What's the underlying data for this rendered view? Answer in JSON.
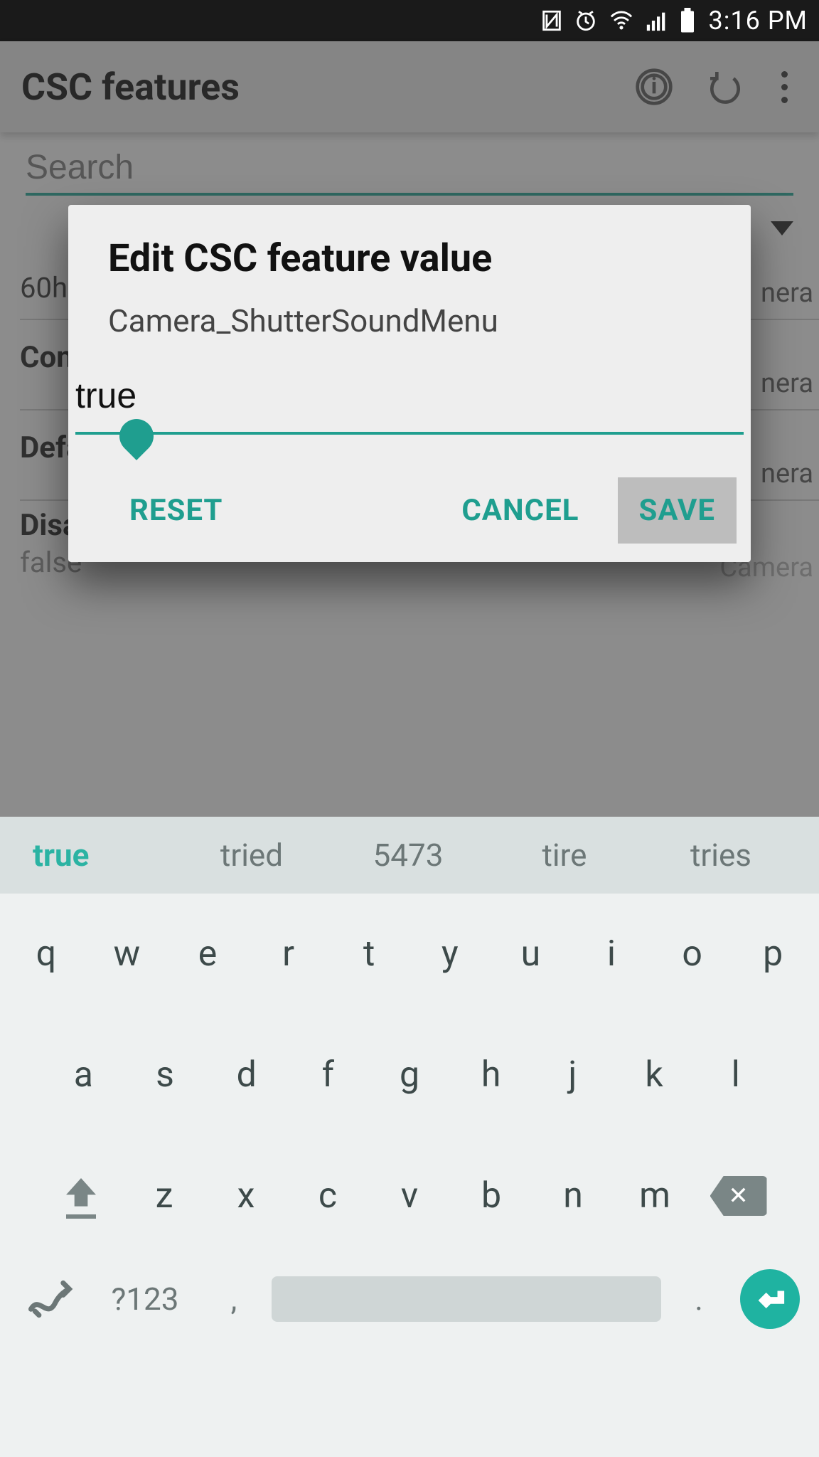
{
  "status": {
    "time": "3:16 PM"
  },
  "toolbar": {
    "title": "CSC features"
  },
  "search": {
    "placeholder": "Search"
  },
  "list": {
    "items": [
      {
        "title": "",
        "sub": "60h",
        "tag": "nera"
      },
      {
        "title": "Con",
        "sub": "",
        "tag": "nera"
      },
      {
        "title": "Defa",
        "sub": "",
        "tag": "nera"
      },
      {
        "title": "Disable GPSMenu",
        "sub": "false",
        "tag": "Camera"
      }
    ]
  },
  "dialog": {
    "title": "Edit CSC feature value",
    "feature": "Camera_ShutterSoundMenu",
    "value": "true",
    "reset": "RESET",
    "cancel": "CANCEL",
    "save": "SAVE"
  },
  "keyboard": {
    "suggestions": [
      "true",
      "tried",
      "5473",
      "tire",
      "tries"
    ],
    "row1": [
      "q",
      "w",
      "e",
      "r",
      "t",
      "y",
      "u",
      "i",
      "o",
      "p"
    ],
    "row2": [
      "a",
      "s",
      "d",
      "f",
      "g",
      "h",
      "j",
      "k",
      "l"
    ],
    "row3": [
      "z",
      "x",
      "c",
      "v",
      "b",
      "n",
      "m"
    ],
    "numLabel": "?123",
    "comma": ",",
    "period": "."
  }
}
